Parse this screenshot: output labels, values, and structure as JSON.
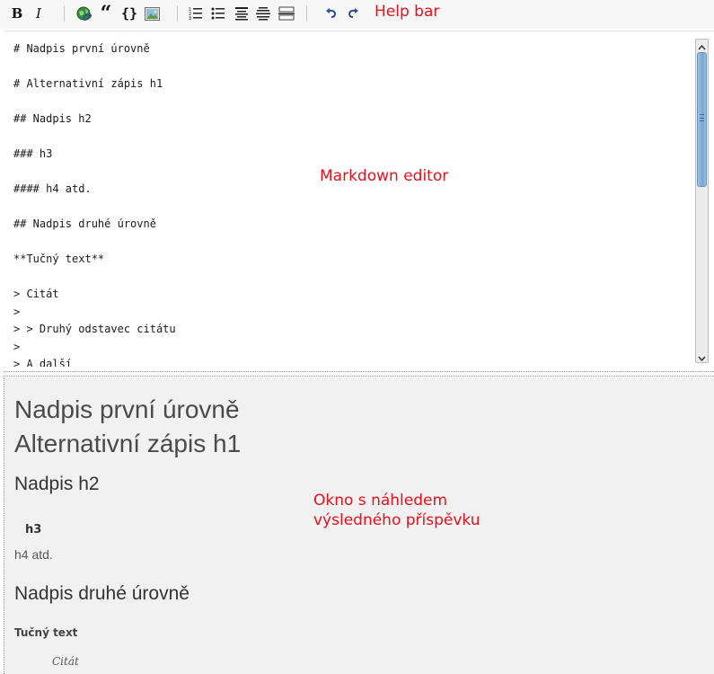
{
  "toolbar": {
    "buttons": [
      {
        "name": "bold",
        "label": "B"
      },
      {
        "name": "italic",
        "label": "I"
      },
      {
        "name": "link"
      },
      {
        "name": "quote",
        "label": "“"
      },
      {
        "name": "code",
        "label": "{}"
      },
      {
        "name": "image"
      },
      {
        "name": "numbered-list"
      },
      {
        "name": "bulleted-list"
      },
      {
        "name": "heading"
      },
      {
        "name": "horizontal-rule"
      },
      {
        "name": "undo"
      },
      {
        "name": "redo"
      }
    ],
    "help_label": "Help bar"
  },
  "editor": {
    "lines": [
      "# Nadpis první úrovně",
      "",
      "# Alternativní zápis h1",
      "",
      "## Nadpis h2",
      "",
      "### h3",
      "",
      "#### h4 atd.",
      "",
      "## Nadpis druhé úrovně",
      "",
      "**Tučný text**",
      "",
      "> Citát",
      ">",
      "> > Druhý odstavec citátu",
      ">",
      "> A další"
    ],
    "annotation": "Markdown editor"
  },
  "preview": {
    "h1_first": "Nadpis první úrovně",
    "h1_second": "Alternativní zápis h1",
    "h2_first": "Nadpis h2",
    "h3": "h3",
    "h4": "h4 atd.",
    "h2_second": "Nadpis druhé úrovně",
    "bold_text": "Tučný text",
    "quote": "Citát",
    "annotation_line1": "Okno s náhledem",
    "annotation_line2": "výsledného příspěvku"
  },
  "colors": {
    "annotation": "#e8101a",
    "preview_background": "#f1f1f1",
    "toolbar_background": "#f6f6f6",
    "scrollbar_thumb": "#7aa4cf"
  }
}
